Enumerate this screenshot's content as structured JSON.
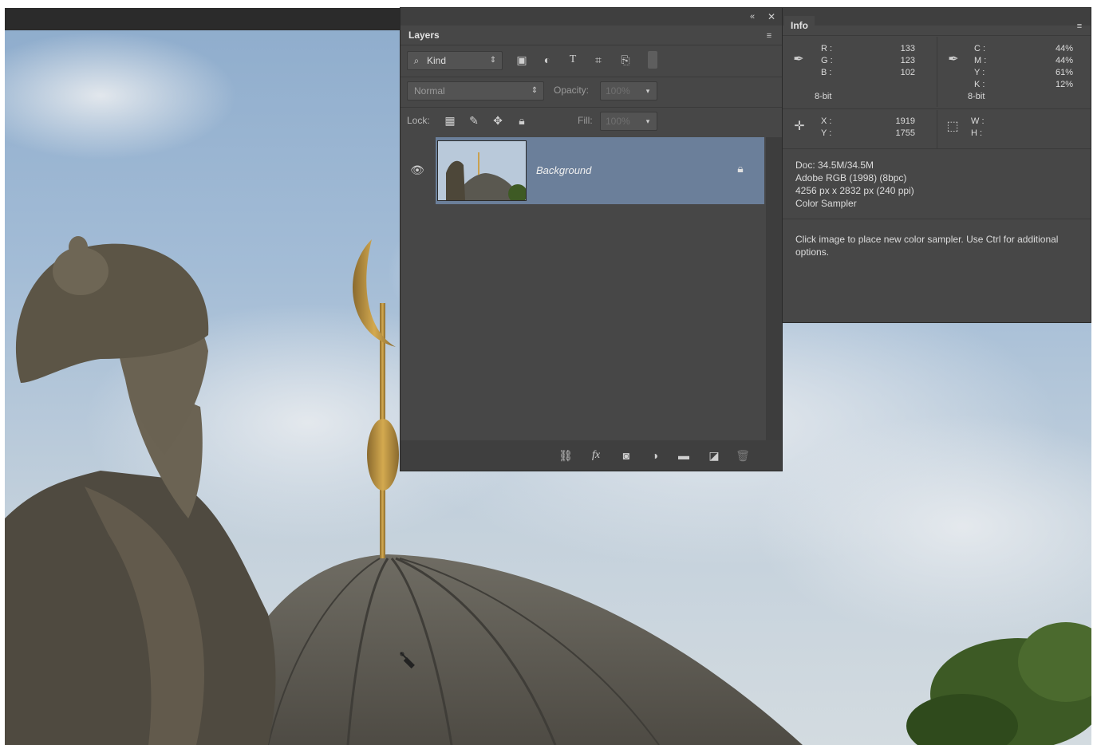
{
  "layers_panel": {
    "tab_label": "Layers",
    "filter_kind": "Kind",
    "blend_mode": "Normal",
    "opacity_label": "Opacity:",
    "opacity_value": "100%",
    "lock_label": "Lock:",
    "fill_label": "Fill:",
    "fill_value": "100%",
    "layers": [
      {
        "name": "Background"
      }
    ]
  },
  "info_panel": {
    "tab_label": "Info",
    "rgb": {
      "r_label": "R :",
      "r": "133",
      "g_label": "G :",
      "g": "123",
      "b_label": "B :",
      "b": "102",
      "depth": "8-bit"
    },
    "cmyk": {
      "c_label": "C :",
      "c": "44%",
      "m_label": "M :",
      "m": "44%",
      "y_label": "Y :",
      "y": "61%",
      "k_label": "K :",
      "k": "12%",
      "depth": "8-bit"
    },
    "pos": {
      "x_label": "X :",
      "x": "1919",
      "y_label": "Y :",
      "y": "1755"
    },
    "size": {
      "w_label": "W :",
      "h_label": "H :"
    },
    "doc": "Doc: 34.5M/34.5M",
    "profile": "Adobe RGB (1998) (8bpc)",
    "dimensions": "4256 px x 2832 px (240 ppi)",
    "tool": "Color Sampler",
    "hint": "Click image to place new color sampler.  Use Ctrl for additional options."
  },
  "colors": {
    "panel_bg": "#474747",
    "layer_selected": "#6b7f9a",
    "sky": "#a3bcd6",
    "statue": "#5a5244"
  }
}
